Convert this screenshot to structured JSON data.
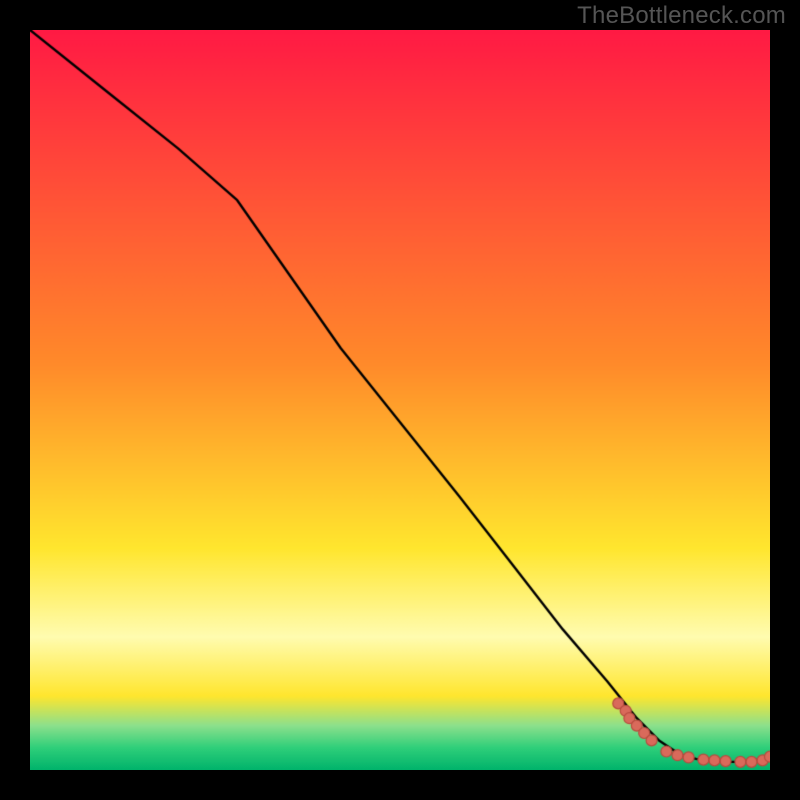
{
  "watermark": "TheBottleneck.com",
  "colors": {
    "black": "#000000",
    "line": "#000000",
    "point_fill": "#d96a5b",
    "point_stroke": "#b84b3f",
    "grad_top": "#ff1a44",
    "grad_mid_upper": "#ff8a2a",
    "grad_mid": "#ffe62e",
    "grad_band": "#fffcb0",
    "grad_green1": "#8ce08c",
    "grad_green2": "#2fcf7a",
    "grad_green3": "#00b36b"
  },
  "chart_data": {
    "type": "line",
    "title": "",
    "xlabel": "",
    "ylabel": "",
    "xlim": [
      0,
      100
    ],
    "ylim": [
      0,
      100
    ],
    "grid": false,
    "legend": false,
    "series": [
      {
        "name": "curve",
        "x": [
          0,
          10,
          20,
          28,
          35,
          42,
          50,
          58,
          65,
          72,
          78,
          82,
          85,
          88,
          90,
          92,
          94,
          96,
          98,
          100
        ],
        "y": [
          100,
          92,
          84,
          77,
          67,
          57,
          47,
          37,
          28,
          19,
          12,
          7,
          4,
          2,
          1.5,
          1.2,
          1.1,
          1.1,
          1.3,
          1.8
        ]
      }
    ],
    "scatter": {
      "name": "cluster",
      "x": [
        79.5,
        80.5,
        81.0,
        82.0,
        83.0,
        84.0,
        86.0,
        87.5,
        89.0,
        91.0,
        92.5,
        94.0,
        96.0,
        97.5,
        99.0,
        100.0
      ],
      "y": [
        9.0,
        8.0,
        7.0,
        6.0,
        5.0,
        4.0,
        2.5,
        2.0,
        1.7,
        1.4,
        1.3,
        1.2,
        1.1,
        1.1,
        1.3,
        1.8
      ]
    },
    "gradient_stops": [
      {
        "pos": 0.0,
        "color": "grad_top"
      },
      {
        "pos": 0.45,
        "color": "grad_mid_upper"
      },
      {
        "pos": 0.7,
        "color": "grad_mid"
      },
      {
        "pos": 0.82,
        "color": "grad_band"
      },
      {
        "pos": 0.9,
        "color": "grad_mid"
      },
      {
        "pos": 0.94,
        "color": "grad_green1"
      },
      {
        "pos": 0.97,
        "color": "grad_green2"
      },
      {
        "pos": 1.0,
        "color": "grad_green3"
      }
    ]
  }
}
